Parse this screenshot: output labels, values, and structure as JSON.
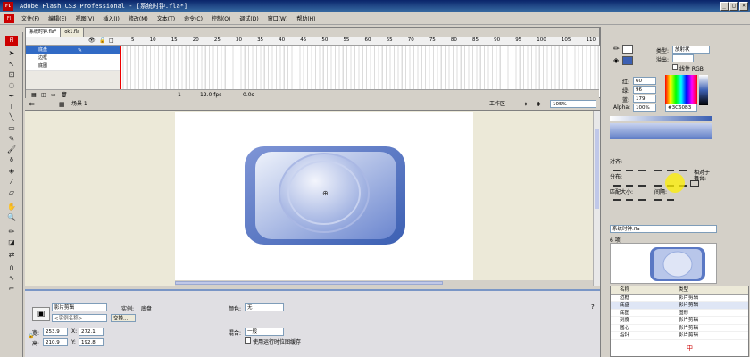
{
  "window": {
    "title": "Adobe Flash CS3 Professional - [系统时钟.fla*]",
    "logo": "Fl",
    "controls": [
      "_",
      "□",
      "×"
    ]
  },
  "menu": {
    "items": [
      "文件(F)",
      "编辑(E)",
      "视图(V)",
      "插入(I)",
      "修改(M)",
      "文本(T)",
      "命令(C)",
      "控制(O)",
      "调试(D)",
      "窗口(W)",
      "帮助(H)"
    ]
  },
  "timeline": {
    "tabs": [
      "系统时钟.fla*",
      "ok1.fla"
    ],
    "frame_numbers": [
      "5",
      "10",
      "15",
      "20",
      "25",
      "30",
      "35",
      "40",
      "45",
      "50",
      "55",
      "60",
      "65",
      "70",
      "75",
      "80",
      "85",
      "90",
      "95",
      "100",
      "105",
      "110"
    ],
    "layers": [
      {
        "name": "底盘",
        "selected": true
      },
      {
        "name": "边框",
        "selected": false
      },
      {
        "name": "底图",
        "selected": false
      }
    ],
    "status": {
      "frame": "1",
      "fps": "12.0 fps",
      "time": "0.0s"
    }
  },
  "editbar": {
    "scene": "场景 1",
    "workspace": "工作区",
    "zoom": "105%"
  },
  "properties": {
    "symbol_type": "影片剪辑",
    "instance_label": "实例:",
    "instance_name": "底盘",
    "instance_placeholder": "<实例名称>",
    "swap_button": "交换...",
    "color_label": "颜色:",
    "color_value": "无",
    "blend_label": "混合:",
    "blend_value": "一般",
    "cache_label": "使用运行时位图缓存",
    "w_label": "宽:",
    "w_value": "253.9",
    "h_label": "高:",
    "h_value": "210.9",
    "x_label": "X:",
    "x_value": "272.1",
    "y_label": "Y:",
    "y_value": "192.8"
  },
  "color_panel": {
    "type_label": "类型:",
    "type_value": "放射状",
    "overflow_label": "溢出:",
    "linear_rgb": "线性 RGB",
    "r_label": "红:",
    "r_value": "60",
    "g_label": "绿:",
    "g_value": "96",
    "b_label": "蓝:",
    "b_value": "179",
    "alpha_label": "Alpha:",
    "alpha_value": "100%",
    "hex_value": "#3C60B3"
  },
  "align_panel": {
    "title": "对齐:",
    "distribute": "分布:",
    "match_size": "匹配大小:",
    "spacing": "间隔:",
    "relative_to": "相对于",
    "stage": "舞台:"
  },
  "library": {
    "file": "系统时钟.fla",
    "count": "6 项",
    "columns": [
      "名称",
      "类型"
    ],
    "items": [
      {
        "name": "边框",
        "type": "影片剪辑"
      },
      {
        "name": "底盘",
        "type": "影片剪辑"
      },
      {
        "name": "底图",
        "type": "图形"
      },
      {
        "name": "刻度",
        "type": "影片剪辑"
      },
      {
        "name": "圆心",
        "type": "影片剪辑"
      },
      {
        "name": "指针",
        "type": "影片剪辑"
      }
    ]
  },
  "tray": {
    "ime": "中"
  },
  "colors": {
    "accent": "#3C60B3",
    "title_bar": "#0a246a",
    "selected_layer": "#316ac5"
  }
}
